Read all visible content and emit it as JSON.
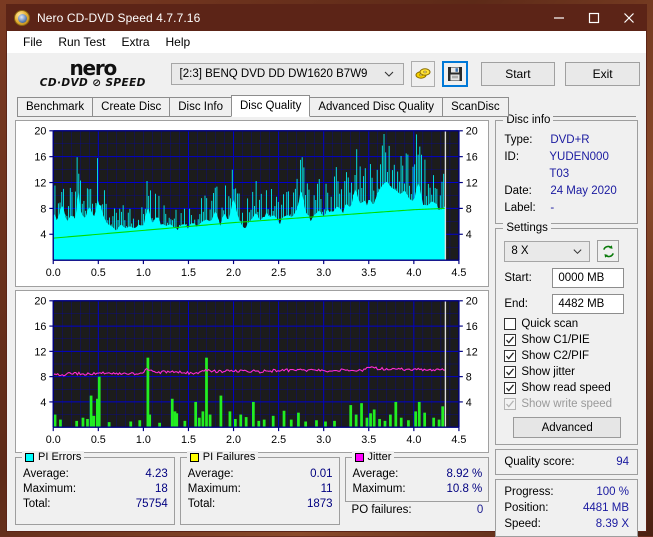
{
  "window": {
    "title": "Nero CD-DVD Speed 4.7.7.16",
    "app_icon": "nero-disc-icon",
    "minimize_label": "—",
    "maximize_label": "□",
    "close_label": "✕"
  },
  "menu": {
    "items": [
      {
        "label": "File"
      },
      {
        "label": "Run Test"
      },
      {
        "label": "Extra"
      },
      {
        "label": "Help"
      }
    ]
  },
  "toolbar": {
    "logo_line1": "nero",
    "logo_line2": "CD·DVD ⊘ SPEED",
    "drive_value": "[2:3]   BENQ DVD DD DW1620 B7W9",
    "eject_icon": "eject-disc-icon",
    "save_icon": "floppy-save-icon",
    "start_label": "Start",
    "exit_label": "Exit"
  },
  "tabs": [
    {
      "label": "Benchmark",
      "active": false
    },
    {
      "label": "Create Disc",
      "active": false
    },
    {
      "label": "Disc Info",
      "active": false
    },
    {
      "label": "Disc Quality",
      "active": true
    },
    {
      "label": "Advanced Disc Quality",
      "active": false
    },
    {
      "label": "ScanDisc",
      "active": false
    }
  ],
  "disc_info": {
    "legend": "Disc info",
    "rows": [
      {
        "key": "Type:",
        "value": "DVD+R"
      },
      {
        "key": "ID:",
        "value": "YUDEN000 T03"
      },
      {
        "key": "Date:",
        "value": "24 May 2020"
      },
      {
        "key": "Label:",
        "value": "-"
      }
    ]
  },
  "settings": {
    "legend": "Settings",
    "speed_value": "8 X",
    "refresh_icon": "refresh-icon",
    "start_label": "Start:",
    "start_value": "0000 MB",
    "end_label": "End:",
    "end_value": "4482 MB",
    "checkboxes": [
      {
        "label": "Quick scan",
        "checked": false,
        "disabled": false
      },
      {
        "label": "Show C1/PIE",
        "checked": true,
        "disabled": false
      },
      {
        "label": "Show C2/PIF",
        "checked": true,
        "disabled": false
      },
      {
        "label": "Show jitter",
        "checked": true,
        "disabled": false
      },
      {
        "label": "Show read speed",
        "checked": true,
        "disabled": false
      },
      {
        "label": "Show write speed",
        "checked": true,
        "disabled": true
      }
    ],
    "advanced_label": "Advanced"
  },
  "quality": {
    "label": "Quality score:",
    "value": "94"
  },
  "progress": {
    "rows": [
      {
        "key": "Progress:",
        "value": "100 %"
      },
      {
        "key": "Position:",
        "value": "4481 MB"
      },
      {
        "key": "Speed:",
        "value": "8.39 X"
      }
    ]
  },
  "stats": {
    "pi_errors": {
      "title": "PI Errors",
      "color": "#00ffff",
      "rows": [
        {
          "key": "Average:",
          "value": "4.23"
        },
        {
          "key": "Maximum:",
          "value": "18"
        },
        {
          "key": "Total:",
          "value": "75754"
        }
      ]
    },
    "pi_failures": {
      "title": "PI Failures",
      "color": "#ffff00",
      "rows": [
        {
          "key": "Average:",
          "value": "0.01"
        },
        {
          "key": "Maximum:",
          "value": "11"
        },
        {
          "key": "Total:",
          "value": "1873"
        }
      ]
    },
    "jitter": {
      "title": "Jitter",
      "color": "#ff00ff",
      "rows": [
        {
          "key": "Average:",
          "value": "8.92 %"
        },
        {
          "key": "Maximum:",
          "value": "10.8 %"
        }
      ],
      "po_key": "PO failures:",
      "po_value": "0"
    }
  },
  "chart_data": [
    {
      "id": "pi-errors-chart",
      "type": "area",
      "title": "PI Errors / read speed",
      "xlabel": "",
      "ylabel": "",
      "xlim": [
        0.0,
        4.5
      ],
      "ylim": [
        0,
        20
      ],
      "xticks": [
        "0.0",
        "0.5",
        "1.0",
        "1.5",
        "2.0",
        "2.5",
        "3.0",
        "3.5",
        "4.0",
        "4.5"
      ],
      "yticks": [
        "4",
        "8",
        "12",
        "16",
        "20"
      ],
      "grid": true,
      "background": "#1c1c1c",
      "grid_color": "#0000cd",
      "data_end_x": 4.35,
      "series": [
        {
          "name": "PI Errors",
          "color": "#00ffff",
          "type": "area",
          "x": [
            0.0,
            0.05,
            0.1,
            0.15,
            0.2,
            0.25,
            0.28,
            0.3,
            0.35,
            0.4,
            0.45,
            0.48,
            0.5,
            0.55,
            0.6,
            0.65,
            0.7,
            0.75,
            0.8,
            0.85,
            0.9,
            0.95,
            1.0,
            1.05,
            1.1,
            1.15,
            1.2,
            1.25,
            1.3,
            1.35,
            1.4,
            1.45,
            1.5,
            1.55,
            1.6,
            1.65,
            1.7,
            1.75,
            1.8,
            1.85,
            1.9,
            1.95,
            2.0,
            2.05,
            2.1,
            2.15,
            2.2,
            2.25,
            2.3,
            2.35,
            2.4,
            2.45,
            2.5,
            2.55,
            2.6,
            2.65,
            2.7,
            2.75,
            2.8,
            2.85,
            2.9,
            2.95,
            3.0,
            3.05,
            3.1,
            3.15,
            3.2,
            3.25,
            3.3,
            3.35,
            3.4,
            3.45,
            3.5,
            3.55,
            3.6,
            3.65,
            3.7,
            3.75,
            3.8,
            3.85,
            3.9,
            3.95,
            4.0,
            4.05,
            4.1,
            4.15,
            4.2,
            4.25,
            4.3,
            4.35
          ],
          "y": [
            11.0,
            9.0,
            12.5,
            8.5,
            10.0,
            9.0,
            16.5,
            11.0,
            9.0,
            12.0,
            9.5,
            11.5,
            14.8,
            10.0,
            8.0,
            7.5,
            6.5,
            8.0,
            7.0,
            7.5,
            7.0,
            8.0,
            7.5,
            12.0,
            8.0,
            10.0,
            8.5,
            7.5,
            8.0,
            7.0,
            7.5,
            8.0,
            7.5,
            8.5,
            7.5,
            8.5,
            9.0,
            8.5,
            11.0,
            8.0,
            10.5,
            9.0,
            14.0,
            9.5,
            7.5,
            8.0,
            9.0,
            10.5,
            8.5,
            11.0,
            9.5,
            10.0,
            8.5,
            9.5,
            10.0,
            9.5,
            11.0,
            16.0,
            10.5,
            9.5,
            10.0,
            11.0,
            9.5,
            11.5,
            10.5,
            12.0,
            11.0,
            12.5,
            11.5,
            16.0,
            12.5,
            13.0,
            14.0,
            12.0,
            15.0,
            16.5,
            17.5,
            16.0,
            15.5,
            14.5,
            15.5,
            13.5,
            13.0,
            17.5,
            12.5,
            12.0,
            13.0,
            12.5,
            11.0,
            12.0
          ]
        },
        {
          "name": "Read speed",
          "color": "#00dd00",
          "type": "line",
          "x": [
            0.0,
            0.5,
            1.0,
            1.5,
            2.0,
            2.5,
            3.0,
            3.5,
            4.0,
            4.35
          ],
          "y": [
            3.4,
            4.0,
            4.6,
            5.2,
            5.8,
            6.3,
            6.8,
            7.3,
            7.8,
            8.0
          ]
        }
      ]
    },
    {
      "id": "pi-failures-jitter-chart",
      "type": "bar",
      "title": "PI Failures / Jitter",
      "xlabel": "",
      "ylabel": "",
      "xlim": [
        0.0,
        4.5
      ],
      "ylim": [
        0,
        20
      ],
      "xticks": [
        "0.0",
        "0.5",
        "1.0",
        "1.5",
        "2.0",
        "2.5",
        "3.0",
        "3.5",
        "4.0",
        "4.5"
      ],
      "yticks": [
        "4",
        "8",
        "12",
        "16",
        "20"
      ],
      "grid": true,
      "background": "#1c1c1c",
      "grid_color": "#0000cd",
      "data_end_x": 4.35,
      "series": [
        {
          "name": "PI Failures",
          "color": "#22ee22",
          "type": "bar",
          "x": [
            0.02,
            0.08,
            0.26,
            0.33,
            0.38,
            0.42,
            0.45,
            0.49,
            0.51,
            0.62,
            0.86,
            0.96,
            1.05,
            1.07,
            1.18,
            1.32,
            1.35,
            1.37,
            1.46,
            1.58,
            1.62,
            1.66,
            1.7,
            1.74,
            1.86,
            1.96,
            2.02,
            2.08,
            2.14,
            2.22,
            2.28,
            2.34,
            2.44,
            2.56,
            2.64,
            2.72,
            2.8,
            2.92,
            3.02,
            3.12,
            3.3,
            3.36,
            3.42,
            3.48,
            3.52,
            3.56,
            3.62,
            3.68,
            3.74,
            3.8,
            3.86,
            3.94,
            4.02,
            4.06,
            4.12,
            4.22,
            4.28,
            4.32
          ],
          "y": [
            2.0,
            1.2,
            1.0,
            1.5,
            1.3,
            5.0,
            1.8,
            4.5,
            8.0,
            0.8,
            0.9,
            1.1,
            11.0,
            2.0,
            0.7,
            4.5,
            2.5,
            2.2,
            1.0,
            4.0,
            1.5,
            2.5,
            11.0,
            2.0,
            5.0,
            2.5,
            1.3,
            2.0,
            1.6,
            4.0,
            1.0,
            1.2,
            1.8,
            2.6,
            1.2,
            2.3,
            0.9,
            1.1,
            0.9,
            1.0,
            3.5,
            2.0,
            3.8,
            1.5,
            2.2,
            2.8,
            1.3,
            1.0,
            2.0,
            4.0,
            1.5,
            1.1,
            2.5,
            4.0,
            2.3,
            1.5,
            1.2,
            3.3
          ]
        },
        {
          "name": "Jitter",
          "color": "#ff2bd6",
          "type": "line",
          "x": [
            0.0,
            0.1,
            0.2,
            0.3,
            0.4,
            0.5,
            0.6,
            0.7,
            0.8,
            0.9,
            1.0,
            1.05,
            1.1,
            1.2,
            1.3,
            1.4,
            1.5,
            1.6,
            1.7,
            1.8,
            1.9,
            2.0,
            2.1,
            2.2,
            2.3,
            2.4,
            2.5,
            2.6,
            2.7,
            2.8,
            2.9,
            3.0,
            3.1,
            3.2,
            3.3,
            3.4,
            3.5,
            3.55,
            3.6,
            3.7,
            3.8,
            3.9,
            4.0,
            4.1,
            4.2,
            4.3,
            4.35
          ],
          "y": [
            8.5,
            8.3,
            8.5,
            8.5,
            8.4,
            8.6,
            8.6,
            8.5,
            8.4,
            8.5,
            8.7,
            9.2,
            8.7,
            8.7,
            8.8,
            8.7,
            8.6,
            8.6,
            9.0,
            8.8,
            8.8,
            9.0,
            8.9,
            8.9,
            8.8,
            8.9,
            9.0,
            9.0,
            9.1,
            9.0,
            9.0,
            8.9,
            9.0,
            9.0,
            9.0,
            8.9,
            9.4,
            9.5,
            9.3,
            9.2,
            9.2,
            9.1,
            9.2,
            9.1,
            9.1,
            9.1,
            9.1
          ]
        }
      ]
    }
  ]
}
